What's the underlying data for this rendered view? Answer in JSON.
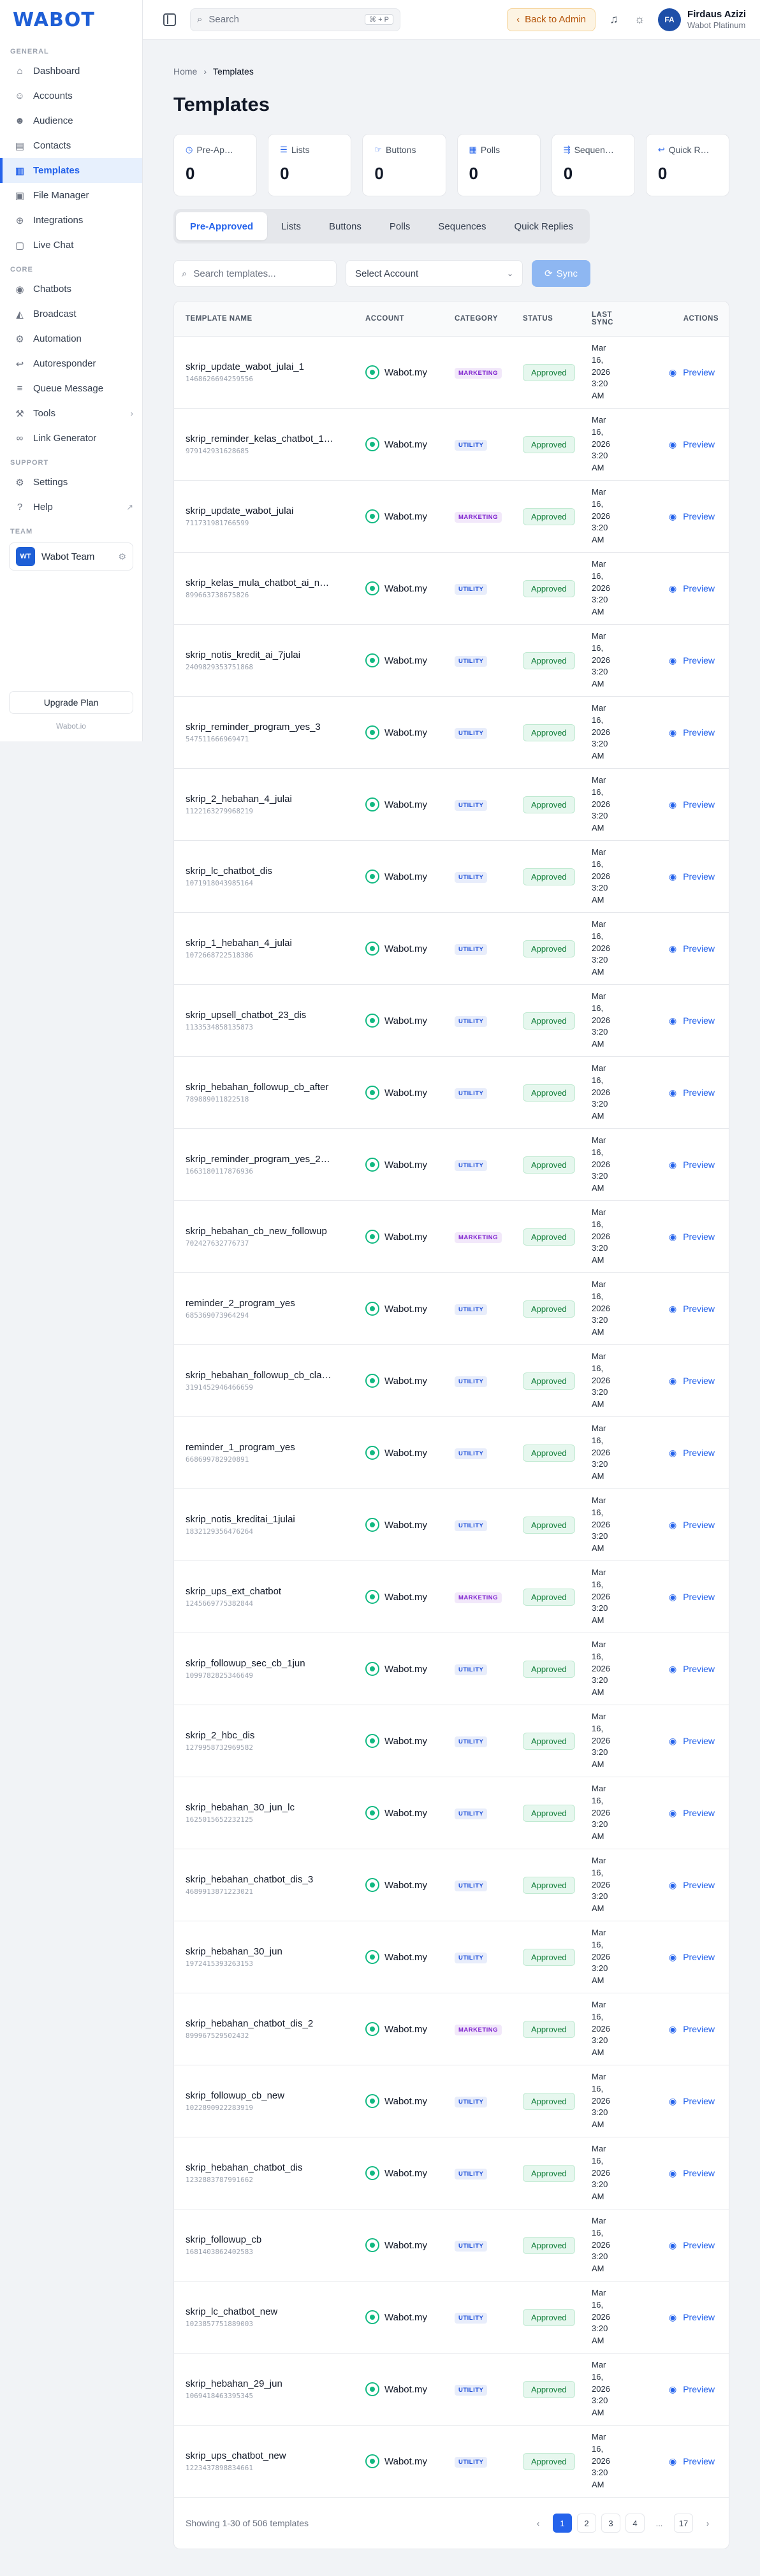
{
  "brand": {
    "logo_text": "WABOT",
    "site": "Wabot.io"
  },
  "sidebar": {
    "sections": [
      {
        "title": "GENERAL",
        "items": [
          {
            "label": "Dashboard",
            "icon": "home-icon"
          },
          {
            "label": "Accounts",
            "icon": "user-icon"
          },
          {
            "label": "Audience",
            "icon": "users-icon"
          },
          {
            "label": "Contacts",
            "icon": "book-icon"
          },
          {
            "label": "Templates",
            "icon": "document-icon",
            "active": true
          },
          {
            "label": "File Manager",
            "icon": "folder-icon"
          },
          {
            "label": "Integrations",
            "icon": "network-icon"
          },
          {
            "label": "Live Chat",
            "icon": "chat-icon"
          }
        ]
      },
      {
        "title": "CORE",
        "items": [
          {
            "label": "Chatbots",
            "icon": "bot-icon"
          },
          {
            "label": "Broadcast",
            "icon": "megaphone-icon"
          },
          {
            "label": "Automation",
            "icon": "automation-icon"
          },
          {
            "label": "Autoresponder",
            "icon": "reply-icon"
          },
          {
            "label": "Queue Message",
            "icon": "queue-icon"
          },
          {
            "label": "Tools",
            "icon": "wrench-icon",
            "tail": "›"
          },
          {
            "label": "Link Generator",
            "icon": "link-icon"
          }
        ]
      },
      {
        "title": "SUPPORT",
        "items": [
          {
            "label": "Settings",
            "icon": "gear-icon"
          },
          {
            "label": "Help",
            "icon": "help-icon",
            "tail": "↗"
          }
        ]
      }
    ],
    "team_title": "TEAM",
    "team": {
      "badge": "WT",
      "name": "Wabot Team"
    },
    "upgrade_label": "Upgrade Plan"
  },
  "topbar": {
    "search_placeholder": "Search",
    "search_kbd": "⌘ + P",
    "back_label": "Back to Admin",
    "user_initials": "FA",
    "user_name": "Firdaus Azizi",
    "user_plan": "Wabot Platinum"
  },
  "breadcrumb": {
    "home": "Home",
    "current": "Templates"
  },
  "page_title": "Templates",
  "stats": [
    {
      "label": "Pre-Ap…",
      "value": "0",
      "icon": "clock-icon"
    },
    {
      "label": "Lists",
      "value": "0",
      "icon": "list-icon"
    },
    {
      "label": "Buttons",
      "value": "0",
      "icon": "pointer-icon"
    },
    {
      "label": "Polls",
      "value": "0",
      "icon": "poll-icon"
    },
    {
      "label": "Sequen…",
      "value": "0",
      "icon": "sequence-icon"
    },
    {
      "label": "Quick R…",
      "value": "0",
      "icon": "reply-icon"
    }
  ],
  "tabs": [
    {
      "label": "Pre-Approved",
      "active": true
    },
    {
      "label": "Lists"
    },
    {
      "label": "Buttons"
    },
    {
      "label": "Polls"
    },
    {
      "label": "Sequences"
    },
    {
      "label": "Quick Replies"
    }
  ],
  "filters": {
    "search_placeholder": "Search templates...",
    "account_select": "Select Account",
    "sync_label": "Sync"
  },
  "table": {
    "headers": {
      "name": "TEMPLATE NAME",
      "account": "ACCOUNT",
      "category": "CATEGORY",
      "status": "STATUS",
      "last_sync": "LAST SYNC",
      "actions": "ACTIONS"
    },
    "account_name": "Wabot.my",
    "status_label": "Approved",
    "sync_lines": [
      "Mar",
      "16,",
      "2026",
      "3:20",
      "AM"
    ],
    "preview_label": "Preview",
    "category_colors": {
      "MARKETING": "#7e22ce",
      "UTILITY": "#1d4ed8"
    },
    "rows": [
      {
        "name": "skrip_update_wabot_julai_1",
        "id": "1468626694259556",
        "category": "MARKETING"
      },
      {
        "name": "skrip_reminder_kelas_chatbot_1…",
        "id": "979142931628685",
        "category": "UTILITY"
      },
      {
        "name": "skrip_update_wabot_julai",
        "id": "711731981766599",
        "category": "MARKETING"
      },
      {
        "name": "skrip_kelas_mula_chatbot_ai_n…",
        "id": "899663738675826",
        "category": "UTILITY"
      },
      {
        "name": "skrip_notis_kredit_ai_7julai",
        "id": "2409829353751868",
        "category": "UTILITY"
      },
      {
        "name": "skrip_reminder_program_yes_3",
        "id": "547511666969471",
        "category": "UTILITY"
      },
      {
        "name": "skrip_2_hebahan_4_julai",
        "id": "1122163279968219",
        "category": "UTILITY"
      },
      {
        "name": "skrip_lc_chatbot_dis",
        "id": "1071918043985164",
        "category": "UTILITY"
      },
      {
        "name": "skrip_1_hebahan_4_julai",
        "id": "1072668722518386",
        "category": "UTILITY"
      },
      {
        "name": "skrip_upsell_chatbot_23_dis",
        "id": "1133534858135873",
        "category": "UTILITY"
      },
      {
        "name": "skrip_hebahan_followup_cb_after",
        "id": "789889011822518",
        "category": "UTILITY"
      },
      {
        "name": "skrip_reminder_program_yes_2…",
        "id": "1663180117876936",
        "category": "UTILITY"
      },
      {
        "name": "skrip_hebahan_cb_new_followup",
        "id": "702427632776737",
        "category": "MARKETING"
      },
      {
        "name": "reminder_2_program_yes",
        "id": "685369073964294",
        "category": "UTILITY"
      },
      {
        "name": "skrip_hebahan_followup_cb_cla…",
        "id": "3191452946466659",
        "category": "UTILITY"
      },
      {
        "name": "reminder_1_program_yes",
        "id": "668699782920891",
        "category": "UTILITY"
      },
      {
        "name": "skrip_notis_kreditai_1julai",
        "id": "1832129356476264",
        "category": "UTILITY"
      },
      {
        "name": "skrip_ups_ext_chatbot",
        "id": "1245669775382844",
        "category": "MARKETING"
      },
      {
        "name": "skrip_followup_sec_cb_1jun",
        "id": "1099782825346649",
        "category": "UTILITY"
      },
      {
        "name": "skrip_2_hbc_dis",
        "id": "1279958732969582",
        "category": "UTILITY"
      },
      {
        "name": "skrip_hebahan_30_jun_lc",
        "id": "1625015652232125",
        "category": "UTILITY"
      },
      {
        "name": "skrip_hebahan_chatbot_dis_3",
        "id": "4689913871223021",
        "category": "UTILITY"
      },
      {
        "name": "skrip_hebahan_30_jun",
        "id": "1972415393263153",
        "category": "UTILITY"
      },
      {
        "name": "skrip_hebahan_chatbot_dis_2",
        "id": "899967529502432",
        "category": "MARKETING"
      },
      {
        "name": "skrip_followup_cb_new",
        "id": "1022890922283919",
        "category": "UTILITY"
      },
      {
        "name": "skrip_hebahan_chatbot_dis",
        "id": "1232883787991662",
        "category": "UTILITY"
      },
      {
        "name": "skrip_followup_cb",
        "id": "1681403862402583",
        "category": "UTILITY"
      },
      {
        "name": "skrip_lc_chatbot_new",
        "id": "1023857751889003",
        "category": "UTILITY"
      },
      {
        "name": "skrip_hebahan_29_jun",
        "id": "1069418463395345",
        "category": "UTILITY"
      },
      {
        "name": "skrip_ups_chatbot_new",
        "id": "1223437898834661",
        "category": "UTILITY"
      }
    ]
  },
  "footer": {
    "showing": "Showing 1-30 of 506 templates",
    "pages": [
      "1",
      "2",
      "3",
      "4",
      "...",
      "17"
    ],
    "prev": "‹",
    "next": "›"
  }
}
